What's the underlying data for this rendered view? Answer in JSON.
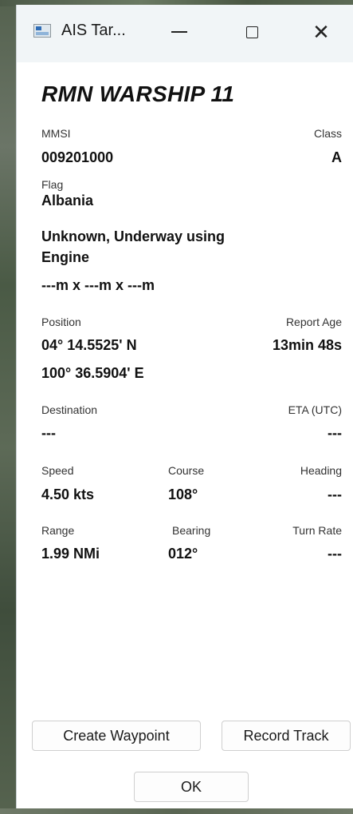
{
  "window": {
    "title": "AIS Tar..."
  },
  "vessel": {
    "name": "RMN WARSHIP 11",
    "mmsi_label": "MMSI",
    "mmsi": "009201000",
    "class_label": "Class",
    "class": "A",
    "flag_label": "Flag",
    "flag": "Albania",
    "status_line1": "Unknown, Underway using",
    "status_line2": "Engine",
    "dimensions": "---m x ---m x ---m"
  },
  "position": {
    "label": "Position",
    "lat": "04° 14.5525' N",
    "lon": "100° 36.5904' E",
    "report_age_label": "Report Age",
    "report_age": "13min 48s"
  },
  "voyage": {
    "destination_label": "Destination",
    "destination": "---",
    "eta_label": "ETA (UTC)",
    "eta": "---"
  },
  "motion": {
    "speed_label": "Speed",
    "speed": "4.50 kts",
    "course_label": "Course",
    "course": "108°",
    "heading_label": "Heading",
    "heading": "---"
  },
  "relative": {
    "range_label": "Range",
    "range": "1.99 NMi",
    "bearing_label": "Bearing",
    "bearing": "012°",
    "turn_rate_label": "Turn Rate",
    "turn_rate": "---"
  },
  "buttons": {
    "create_waypoint": "Create Waypoint",
    "record_track": "Record Track",
    "ok": "OK"
  }
}
